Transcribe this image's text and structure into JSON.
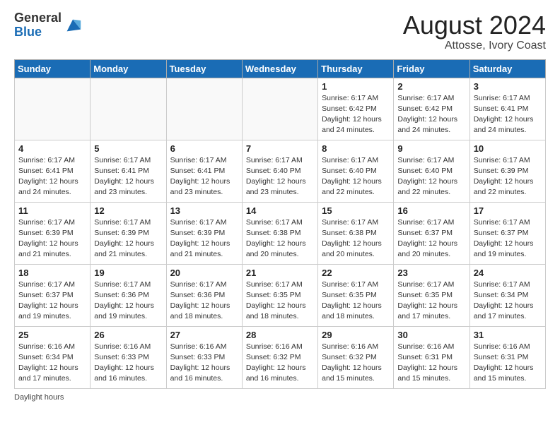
{
  "logo": {
    "general": "General",
    "blue": "Blue"
  },
  "title": "August 2024",
  "location": "Attosse, Ivory Coast",
  "days_of_week": [
    "Sunday",
    "Monday",
    "Tuesday",
    "Wednesday",
    "Thursday",
    "Friday",
    "Saturday"
  ],
  "footer": {
    "label": "Daylight hours"
  },
  "weeks": [
    [
      {
        "day": "",
        "detail": ""
      },
      {
        "day": "",
        "detail": ""
      },
      {
        "day": "",
        "detail": ""
      },
      {
        "day": "",
        "detail": ""
      },
      {
        "day": "1",
        "detail": "Sunrise: 6:17 AM\nSunset: 6:42 PM\nDaylight: 12 hours\nand 24 minutes."
      },
      {
        "day": "2",
        "detail": "Sunrise: 6:17 AM\nSunset: 6:42 PM\nDaylight: 12 hours\nand 24 minutes."
      },
      {
        "day": "3",
        "detail": "Sunrise: 6:17 AM\nSunset: 6:41 PM\nDaylight: 12 hours\nand 24 minutes."
      }
    ],
    [
      {
        "day": "4",
        "detail": "Sunrise: 6:17 AM\nSunset: 6:41 PM\nDaylight: 12 hours\nand 24 minutes."
      },
      {
        "day": "5",
        "detail": "Sunrise: 6:17 AM\nSunset: 6:41 PM\nDaylight: 12 hours\nand 23 minutes."
      },
      {
        "day": "6",
        "detail": "Sunrise: 6:17 AM\nSunset: 6:41 PM\nDaylight: 12 hours\nand 23 minutes."
      },
      {
        "day": "7",
        "detail": "Sunrise: 6:17 AM\nSunset: 6:40 PM\nDaylight: 12 hours\nand 23 minutes."
      },
      {
        "day": "8",
        "detail": "Sunrise: 6:17 AM\nSunset: 6:40 PM\nDaylight: 12 hours\nand 22 minutes."
      },
      {
        "day": "9",
        "detail": "Sunrise: 6:17 AM\nSunset: 6:40 PM\nDaylight: 12 hours\nand 22 minutes."
      },
      {
        "day": "10",
        "detail": "Sunrise: 6:17 AM\nSunset: 6:39 PM\nDaylight: 12 hours\nand 22 minutes."
      }
    ],
    [
      {
        "day": "11",
        "detail": "Sunrise: 6:17 AM\nSunset: 6:39 PM\nDaylight: 12 hours\nand 21 minutes."
      },
      {
        "day": "12",
        "detail": "Sunrise: 6:17 AM\nSunset: 6:39 PM\nDaylight: 12 hours\nand 21 minutes."
      },
      {
        "day": "13",
        "detail": "Sunrise: 6:17 AM\nSunset: 6:39 PM\nDaylight: 12 hours\nand 21 minutes."
      },
      {
        "day": "14",
        "detail": "Sunrise: 6:17 AM\nSunset: 6:38 PM\nDaylight: 12 hours\nand 20 minutes."
      },
      {
        "day": "15",
        "detail": "Sunrise: 6:17 AM\nSunset: 6:38 PM\nDaylight: 12 hours\nand 20 minutes."
      },
      {
        "day": "16",
        "detail": "Sunrise: 6:17 AM\nSunset: 6:37 PM\nDaylight: 12 hours\nand 20 minutes."
      },
      {
        "day": "17",
        "detail": "Sunrise: 6:17 AM\nSunset: 6:37 PM\nDaylight: 12 hours\nand 19 minutes."
      }
    ],
    [
      {
        "day": "18",
        "detail": "Sunrise: 6:17 AM\nSunset: 6:37 PM\nDaylight: 12 hours\nand 19 minutes."
      },
      {
        "day": "19",
        "detail": "Sunrise: 6:17 AM\nSunset: 6:36 PM\nDaylight: 12 hours\nand 19 minutes."
      },
      {
        "day": "20",
        "detail": "Sunrise: 6:17 AM\nSunset: 6:36 PM\nDaylight: 12 hours\nand 18 minutes."
      },
      {
        "day": "21",
        "detail": "Sunrise: 6:17 AM\nSunset: 6:35 PM\nDaylight: 12 hours\nand 18 minutes."
      },
      {
        "day": "22",
        "detail": "Sunrise: 6:17 AM\nSunset: 6:35 PM\nDaylight: 12 hours\nand 18 minutes."
      },
      {
        "day": "23",
        "detail": "Sunrise: 6:17 AM\nSunset: 6:35 PM\nDaylight: 12 hours\nand 17 minutes."
      },
      {
        "day": "24",
        "detail": "Sunrise: 6:17 AM\nSunset: 6:34 PM\nDaylight: 12 hours\nand 17 minutes."
      }
    ],
    [
      {
        "day": "25",
        "detail": "Sunrise: 6:16 AM\nSunset: 6:34 PM\nDaylight: 12 hours\nand 17 minutes."
      },
      {
        "day": "26",
        "detail": "Sunrise: 6:16 AM\nSunset: 6:33 PM\nDaylight: 12 hours\nand 16 minutes."
      },
      {
        "day": "27",
        "detail": "Sunrise: 6:16 AM\nSunset: 6:33 PM\nDaylight: 12 hours\nand 16 minutes."
      },
      {
        "day": "28",
        "detail": "Sunrise: 6:16 AM\nSunset: 6:32 PM\nDaylight: 12 hours\nand 16 minutes."
      },
      {
        "day": "29",
        "detail": "Sunrise: 6:16 AM\nSunset: 6:32 PM\nDaylight: 12 hours\nand 15 minutes."
      },
      {
        "day": "30",
        "detail": "Sunrise: 6:16 AM\nSunset: 6:31 PM\nDaylight: 12 hours\nand 15 minutes."
      },
      {
        "day": "31",
        "detail": "Sunrise: 6:16 AM\nSunset: 6:31 PM\nDaylight: 12 hours\nand 15 minutes."
      }
    ]
  ]
}
